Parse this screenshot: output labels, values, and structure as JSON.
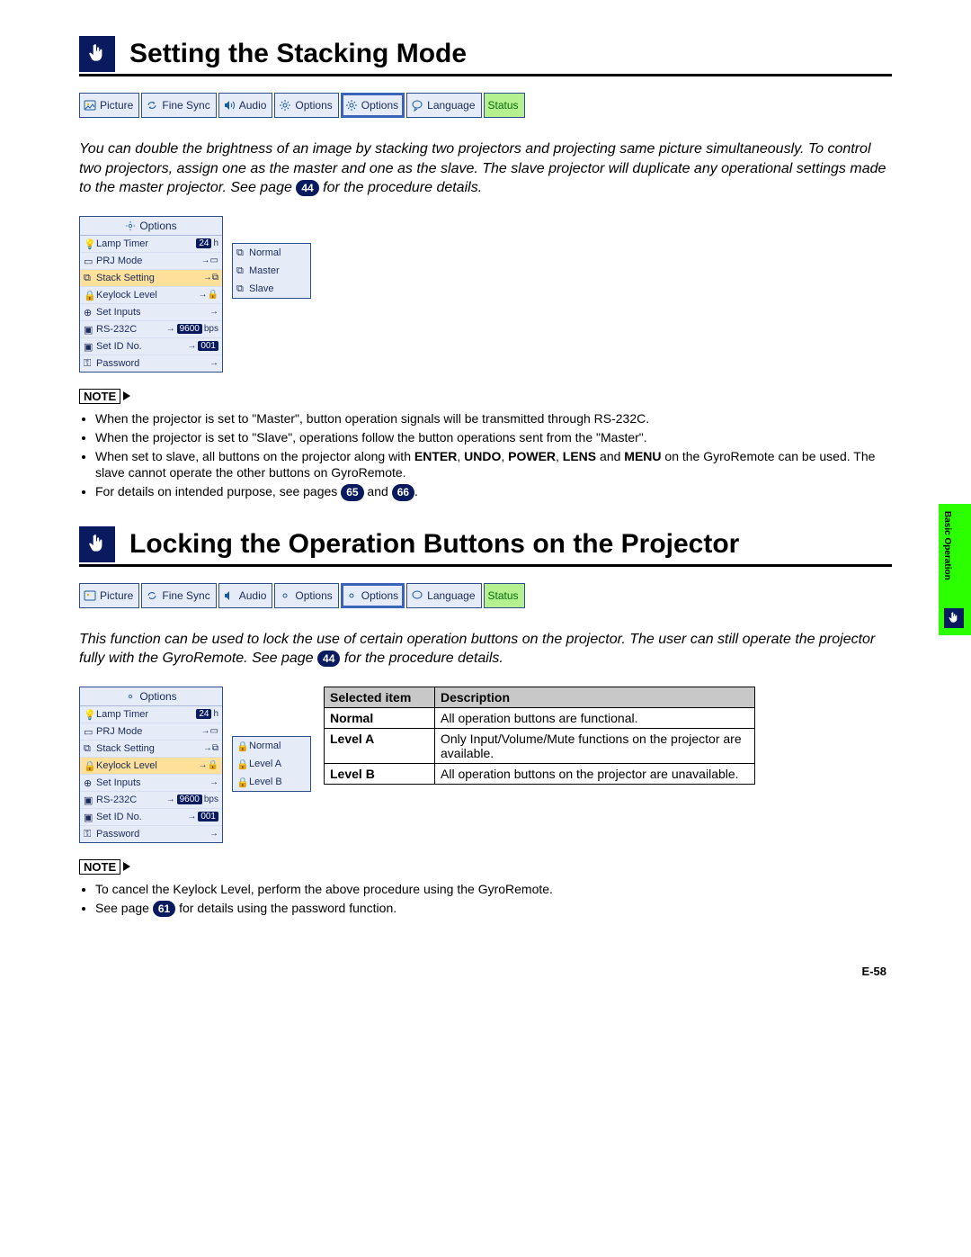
{
  "section1": {
    "title": "Setting the Stacking Mode",
    "intro_pre": "You can double the brightness of an image by stacking two projectors and projecting same picture simultaneously. To control two projectors, assign one as the master and one as the slave. The slave projector will duplicate any operational settings made to the master projector. See page ",
    "intro_ref": "44",
    "intro_post": " for the procedure details."
  },
  "menubar": {
    "picture": "Picture",
    "finesync": "Fine Sync",
    "audio": "Audio",
    "options1": "Options",
    "options2": "Options",
    "language": "Language",
    "status": "Status"
  },
  "osd1": {
    "title": "Options",
    "lamp": "Lamp Timer",
    "lamp_val": "24",
    "lamp_unit": "h",
    "prj": "PRJ Mode",
    "stack": "Stack Setting",
    "keylock": "Keylock Level",
    "setinputs": "Set Inputs",
    "rs232c": "RS-232C",
    "rs232c_val": "9600",
    "rs232c_unit": "bps",
    "setid": "Set ID No.",
    "setid_val": "001",
    "password": "Password"
  },
  "osd1_sub": {
    "normal": "Normal",
    "master": "Master",
    "slave": "Slave"
  },
  "note_label": "NOTE",
  "notes1": {
    "n1": "When the projector is set to \"Master\", button operation signals will be transmitted through RS-232C.",
    "n2": "When the projector is set to \"Slave\", operations follow the button operations sent from the \"Master\".",
    "n3_pre": "When set to slave, all buttons on the projector along with ",
    "n3_b1": "ENTER",
    "n3_c1": ", ",
    "n3_b2": "UNDO",
    "n3_c2": ", ",
    "n3_b3": "POWER",
    "n3_c3": ", ",
    "n3_b4": "LENS",
    "n3_c4": " and ",
    "n3_b5": "MENU",
    "n3_post": " on the GyroRemote can be used. The slave cannot operate the other buttons on GyroRemote.",
    "n4_pre": "For details on intended purpose, see pages ",
    "n4_ref1": "65",
    "n4_and": " and ",
    "n4_ref2": "66",
    "n4_post": "."
  },
  "section2": {
    "title": "Locking the Operation Buttons on the Projector",
    "intro_pre": "This function can be used to lock the use of certain operation buttons on the projector. The user can still operate the projector fully with the GyroRemote. See page ",
    "intro_ref": "44",
    "intro_post": " for the procedure details."
  },
  "osd2_sub": {
    "normal": "Normal",
    "levela": "Level A",
    "levelb": "Level B"
  },
  "table": {
    "h1": "Selected item",
    "h2": "Description",
    "r1c1": "Normal",
    "r1c2": "All operation buttons are functional.",
    "r2c1": "Level A",
    "r2c2": "Only Input/Volume/Mute functions on the projector are available.",
    "r3c1": "Level B",
    "r3c2": "All operation buttons on the projector are unavailable."
  },
  "notes2": {
    "n1": "To cancel the Keylock Level, perform the above procedure using the GyroRemote.",
    "n2_pre": "See page ",
    "n2_ref": "61",
    "n2_post": " for details using the password function."
  },
  "side_tab": "Basic Operation",
  "page_num": "E-58"
}
